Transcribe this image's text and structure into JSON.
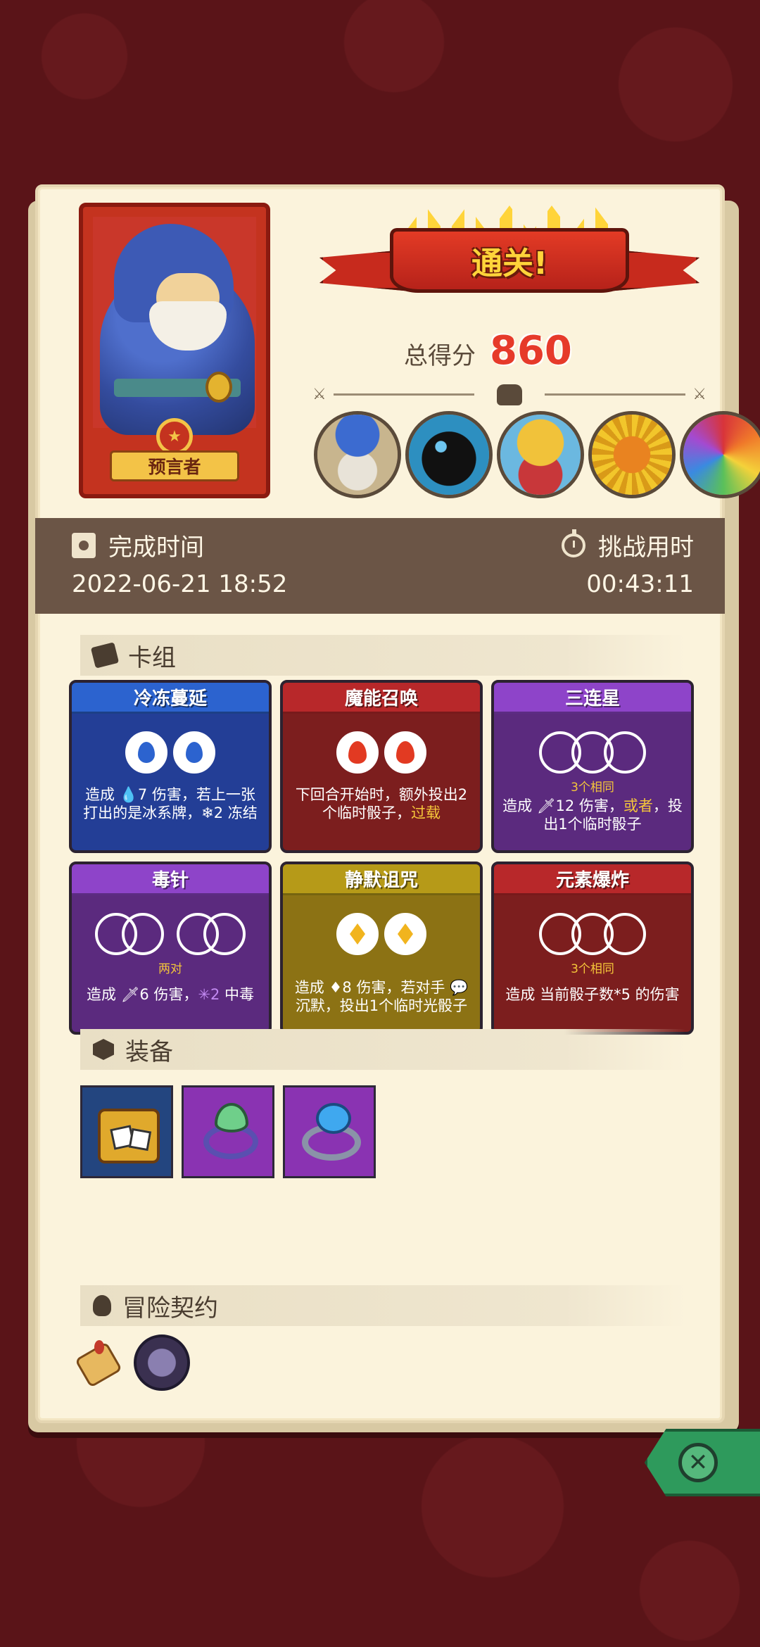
{
  "hero": {
    "name": "预言者"
  },
  "result": {
    "banner": "通关!",
    "score_label": "总得分",
    "score_value": "860"
  },
  "bosses": [
    "mushroom-elder",
    "shadow-beast",
    "golden-mask",
    "pumpkin-sun",
    "rainbow-dragon"
  ],
  "time": {
    "complete_label": "完成时间",
    "complete_value": "2022-06-21 18:52",
    "challenge_label": "挑战用时",
    "challenge_value": "00:43:11"
  },
  "deck": {
    "header": "卡组",
    "cards": [
      {
        "title": "冷冻蔓延",
        "color": "blue",
        "note": "",
        "desc": "造成 💧7 伤害，若上一张打出的是冰系牌，❄2 冻结"
      },
      {
        "title": "魔能召唤",
        "color": "red",
        "note": "",
        "desc_a": "下回合开始时，额外投出2个临时骰子，",
        "desc_b": "过载"
      },
      {
        "title": "三连星",
        "color": "purple",
        "note": "3个相同",
        "desc_a": "造成 🗡12 伤害，",
        "desc_b": "或者",
        "desc_c": "，投出1个临时骰子"
      },
      {
        "title": "毒针",
        "color": "purple",
        "note": "两对",
        "desc_a": "造成 🗡6 伤害，",
        "desc_b": "✳2",
        "desc_c": " 中毒"
      },
      {
        "title": "静默诅咒",
        "color": "olive",
        "note": "",
        "desc": "造成 ♦8 伤害，若对手 💬沉默，投出1个临时光骰子"
      },
      {
        "title": "元素爆炸",
        "color": "red",
        "note": "3个相同",
        "desc": "造成 当前骰子数*5 的伤害"
      }
    ]
  },
  "equipment": {
    "header": "装备",
    "items": [
      "dice-chest",
      "leaf-ring",
      "sapphire-ring"
    ]
  },
  "contract": {
    "header": "冒险契约",
    "items": [
      "scroll",
      "dark-crystal"
    ]
  },
  "colors": {
    "background": "#5a1418",
    "panel": "#fbf3dc",
    "score": "#e63a2a",
    "close_button": "#2e9a5c"
  }
}
